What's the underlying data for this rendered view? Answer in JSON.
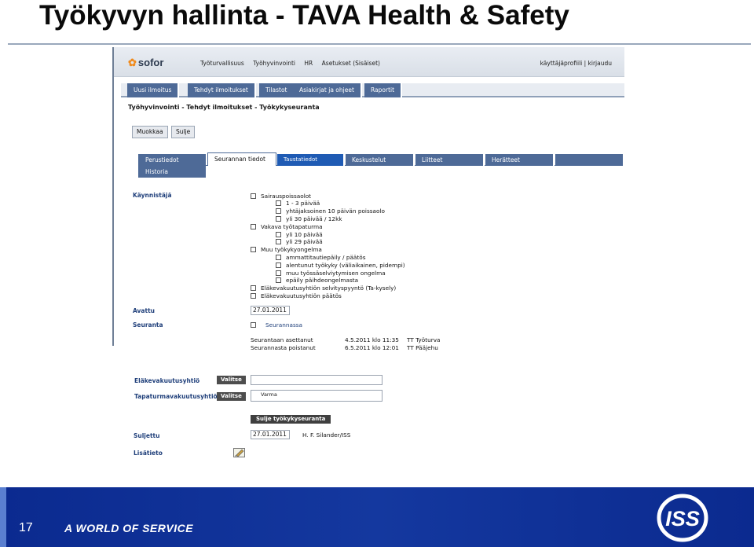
{
  "slide": {
    "title": "Työkyvyn hallinta - TAVA Health & Safety",
    "slide_number": "17",
    "tagline": "A WORLD OF SERVICE",
    "logo_text": "ISS"
  },
  "app": {
    "logo": "sofor",
    "top_nav": [
      "Työturvallisuus",
      "Työhyvinvointi",
      "HR",
      "Asetukset (Sisäiset)"
    ],
    "user_links": "käyttäjäprofiili | kirjaudu",
    "menu": [
      "Uusi ilmoitus",
      "Tehdyt ilmoitukset",
      "Tilastot",
      "Asiakirjat ja ohjeet",
      "Raportit"
    ],
    "page_heading": "Työhyvinvointi - Tehdyt ilmoitukset - Työkykyseuranta",
    "buttons": {
      "edit": "Muokkaa",
      "close": "Sulje"
    },
    "left_tabs": [
      "Perustiedot",
      "Historia"
    ],
    "tabs": [
      "Seurannan tiedot",
      "Taustatiedot",
      "Keskustelut",
      "Liitteet",
      "Herätteet"
    ]
  },
  "form": {
    "trigger_label": "Käynnistäjä",
    "triggers": [
      {
        "level": 0,
        "text": "Sairauspoissaolot"
      },
      {
        "level": 1,
        "text": "1 - 3 päivää"
      },
      {
        "level": 1,
        "text": "yhtäjaksoinen 10 päivän poissaolo"
      },
      {
        "level": 1,
        "text": "yli 30 päivää / 12kk"
      },
      {
        "level": 0,
        "text": "Vakava työtapaturma"
      },
      {
        "level": 1,
        "text": "yli 10 päivää"
      },
      {
        "level": 1,
        "text": "yli 29 päivää"
      },
      {
        "level": 0,
        "text": "Muu työkykyongelma"
      },
      {
        "level": 1,
        "text": "ammattitautiepäily / päätös"
      },
      {
        "level": 1,
        "text": "alentunut työkyky (väliaikainen, pidempi)"
      },
      {
        "level": 1,
        "text": "muu työssäselviytymisen ongelma"
      },
      {
        "level": 1,
        "text": "epäily päihdeongelmasta"
      },
      {
        "level": 0,
        "text": "Eläkevakuutusyhtiön selvityspyyntö (Ta-kysely)"
      },
      {
        "level": 0,
        "text": "Eläkevakuutusyhtiön päätös"
      }
    ],
    "opened_label": "Avattu",
    "opened_value": "27.01.2011",
    "tracking_label": "Seuranta",
    "tracking_checkbox": "Seurannassa",
    "set_label": "Seurantaan asettanut",
    "set_time": "4.5.2011 klo 11:35",
    "set_by": "TT Työturva",
    "removed_label": "Seurannasta poistanut",
    "removed_time": "6.5.2011 klo 12:01",
    "removed_by": "TT Pääjehu",
    "pension_label": "Eläkevakuutusyhtiö",
    "accident_label": "Tapaturmavakuutusyhtiö",
    "select_button": "Valitse",
    "accident_value": "Varma",
    "close_tracking_button": "Sulje työkykyseuranta",
    "closed_label": "Suljettu",
    "closed_value": "27.01.2011",
    "closed_by": "H. F. Silander/ISS",
    "info_label": "Lisätieto"
  },
  "colors": {
    "footer": "#14389f",
    "menu": "#4e6a97",
    "label": "#1f3f7a"
  }
}
